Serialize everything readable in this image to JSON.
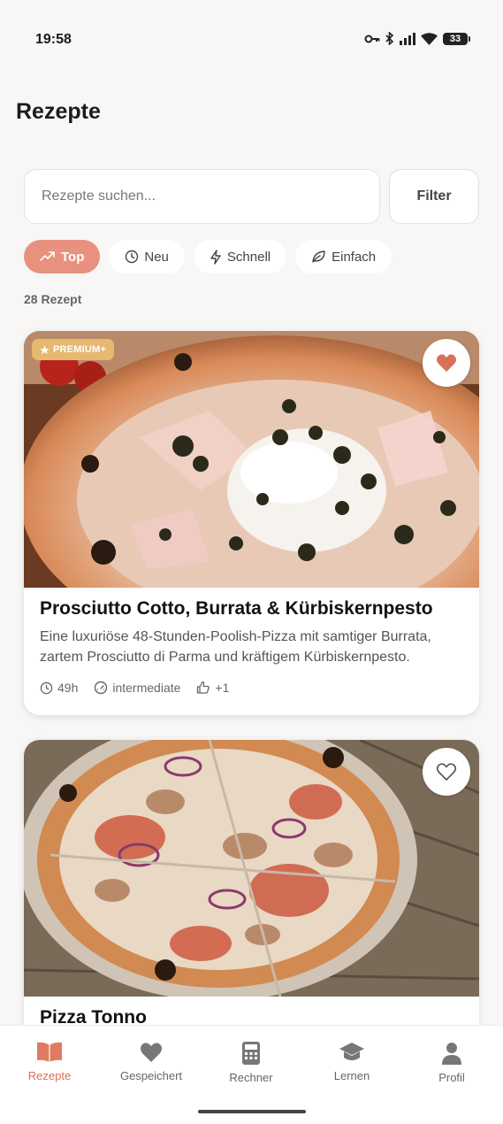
{
  "status": {
    "time": "19:58",
    "battery": "33",
    "icons": [
      "key-icon",
      "bluetooth-icon",
      "signal-icon",
      "wifi-icon",
      "battery-icon"
    ]
  },
  "page": {
    "title": "Rezepte"
  },
  "search": {
    "placeholder": "Rezepte suchen...",
    "filter_label": "Filter"
  },
  "chips": [
    {
      "label": "Top",
      "icon": "trending-up-icon",
      "active": true
    },
    {
      "label": "Neu",
      "icon": "clock-icon",
      "active": false
    },
    {
      "label": "Schnell",
      "icon": "bolt-icon",
      "active": false
    },
    {
      "label": "Einfach",
      "icon": "leaf-icon",
      "active": false
    }
  ],
  "recipe_count": "28 Rezept",
  "recipes": [
    {
      "title": "Prosciutto Cotto, Burrata & Kürbiskernpesto",
      "description": "Eine luxuriöse 48-Stunden-Poolish-Pizza mit samtiger Burrata, zartem Prosciutto di Parma und kräftigem Kürbiskernpesto.",
      "badge": "PREMIUM+",
      "favorite": true,
      "time": "49h",
      "difficulty": "intermediate",
      "likes": "+1"
    },
    {
      "title": "Pizza Tonno",
      "favorite": false
    }
  ],
  "nav": [
    {
      "label": "Rezepte",
      "icon": "book-icon",
      "active": true
    },
    {
      "label": "Gespeichert",
      "icon": "heart-icon",
      "active": false
    },
    {
      "label": "Rechner",
      "icon": "calculator-icon",
      "active": false
    },
    {
      "label": "Lernen",
      "icon": "graduation-cap-icon",
      "active": false
    },
    {
      "label": "Profil",
      "icon": "person-icon",
      "active": false
    }
  ],
  "colors": {
    "accent": "#e8917e",
    "nav_active": "#d86f57",
    "premium": "#e6b870",
    "favorite": "#d9705a"
  }
}
